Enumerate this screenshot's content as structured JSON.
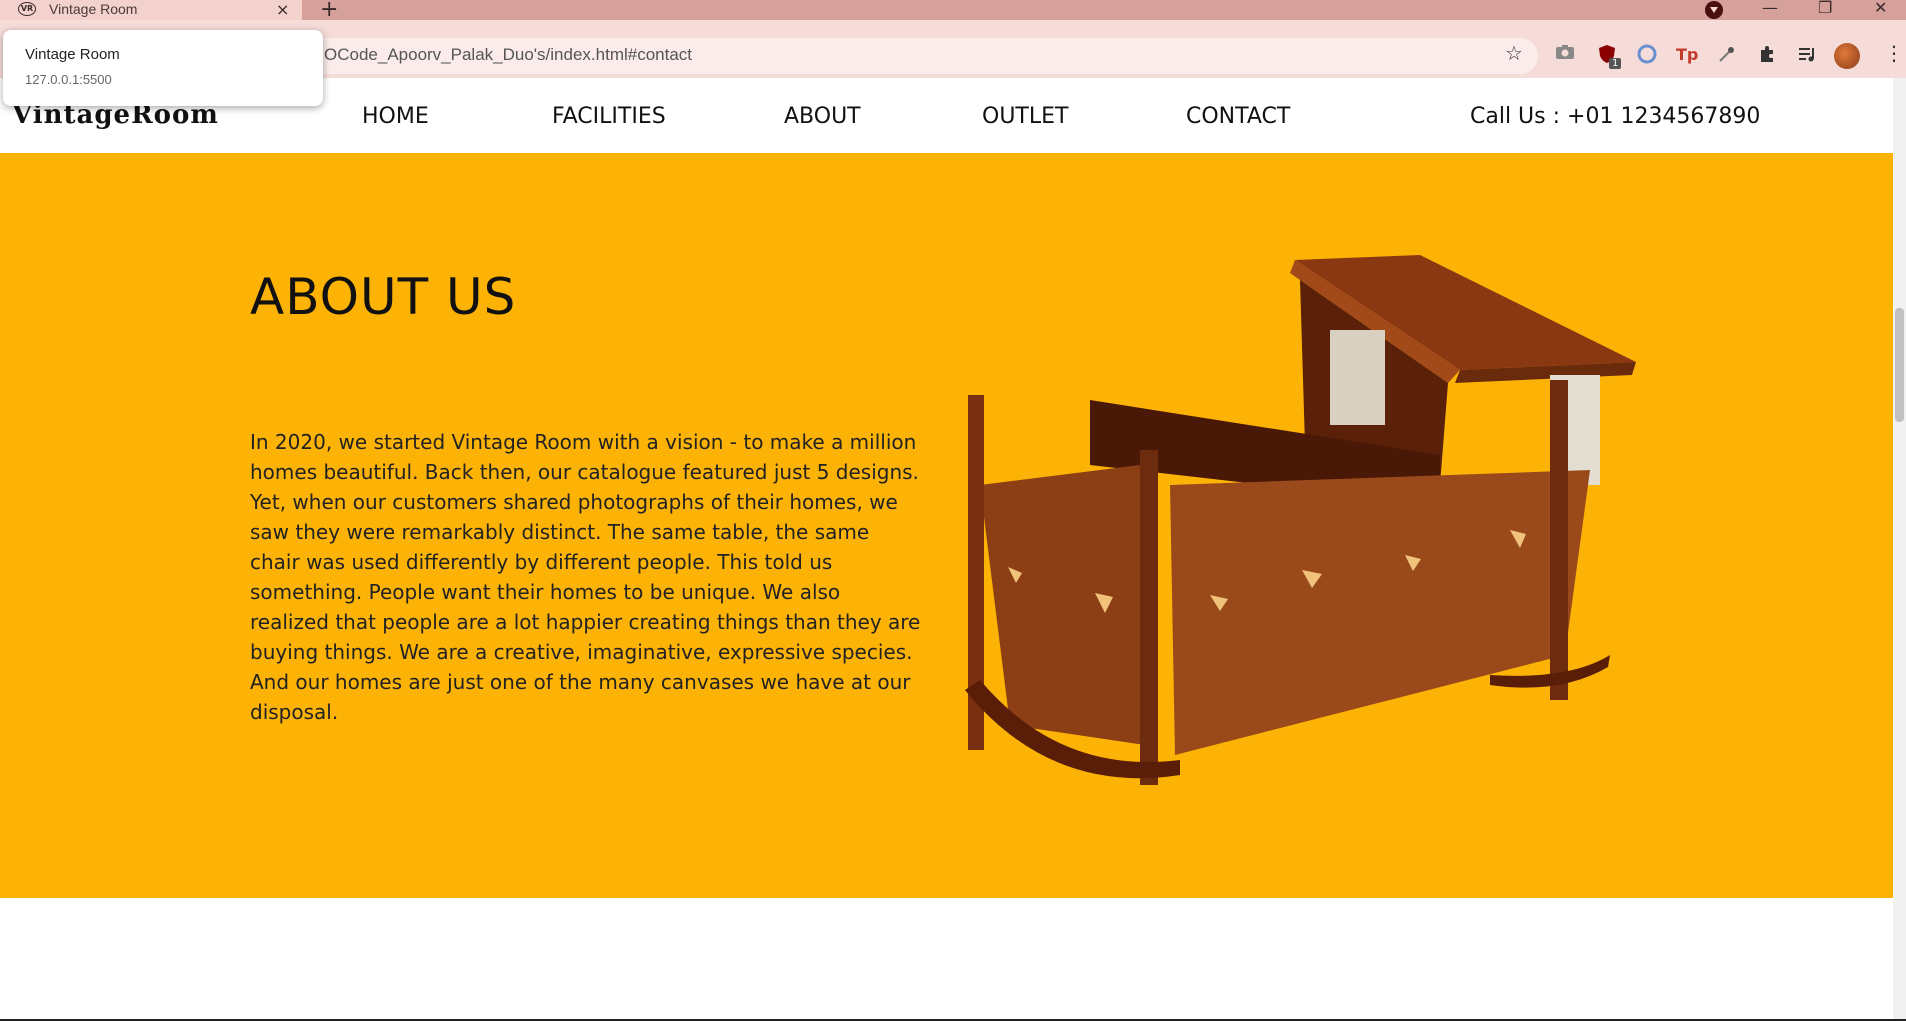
{
  "browser": {
    "tab_title": "Vintage Room",
    "tab_close": "×",
    "new_tab": "+",
    "url": "OCode_Apoorv_Palak_Duo's/index.html#contact",
    "window_controls": [
      "—",
      "❐",
      "✕"
    ],
    "hovercard": {
      "title": "Vintage Room",
      "url": "127.0.0.1:5500"
    },
    "extension_icons": [
      "camera-icon",
      "ublock-icon",
      "sync-icon",
      "tp-icon",
      "eyedropper-icon",
      "puzzle-icon",
      "media-icon"
    ],
    "ext_badge": "1",
    "ext_tp": "Tp"
  },
  "site": {
    "logo": "VintageRoom",
    "nav": [
      "HOME",
      "FACILITIES",
      "ABOUT",
      "OUTLET",
      "CONTACT"
    ],
    "call": "Call Us : +01 1234567890"
  },
  "about": {
    "title": "ABOUT US",
    "text": "In 2020, we started Vintage Room with a vision - to make a million homes beautiful. Back then, our catalogue featured just 5 designs. Yet, when our customers shared photographs of their homes, we saw they were remarkably distinct. The same table, the same chair was used differently by different people. This told us something. People want their homes to be unique. We also realized that people are a lot happier creating things than they are buying things. We are a creative, imaginative, expressive species. And our homes are just one of the many canvases we have at our disposal."
  },
  "colors": {
    "tabstrip": "#d6a19a",
    "toolbar": "#f6dcd9",
    "about_bg": "#fdb306",
    "wood": "#9a4a1a"
  }
}
